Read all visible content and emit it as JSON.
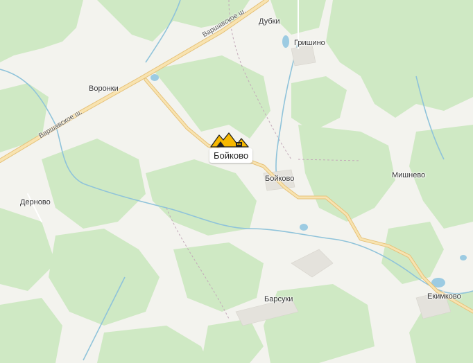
{
  "map": {
    "selected_place": {
      "name": "Бойково",
      "icon": "mountain-building-icon",
      "icon_color": "#f6b800"
    },
    "roads": [
      {
        "name": "Варшавское ш."
      },
      {
        "name": "Варшавское ш."
      }
    ],
    "places": [
      {
        "name": "Дубки"
      },
      {
        "name": "Гришино"
      },
      {
        "name": "Воронки"
      },
      {
        "name": "Бойково"
      },
      {
        "name": "Мишнево"
      },
      {
        "name": "Дерново"
      },
      {
        "name": "Барсуки"
      },
      {
        "name": "Екимково"
      }
    ],
    "colors": {
      "forest": "#cfe9c4",
      "open_land": "#f3f3ee",
      "road": "#f5d89a",
      "water": "#9ccbe2"
    }
  }
}
